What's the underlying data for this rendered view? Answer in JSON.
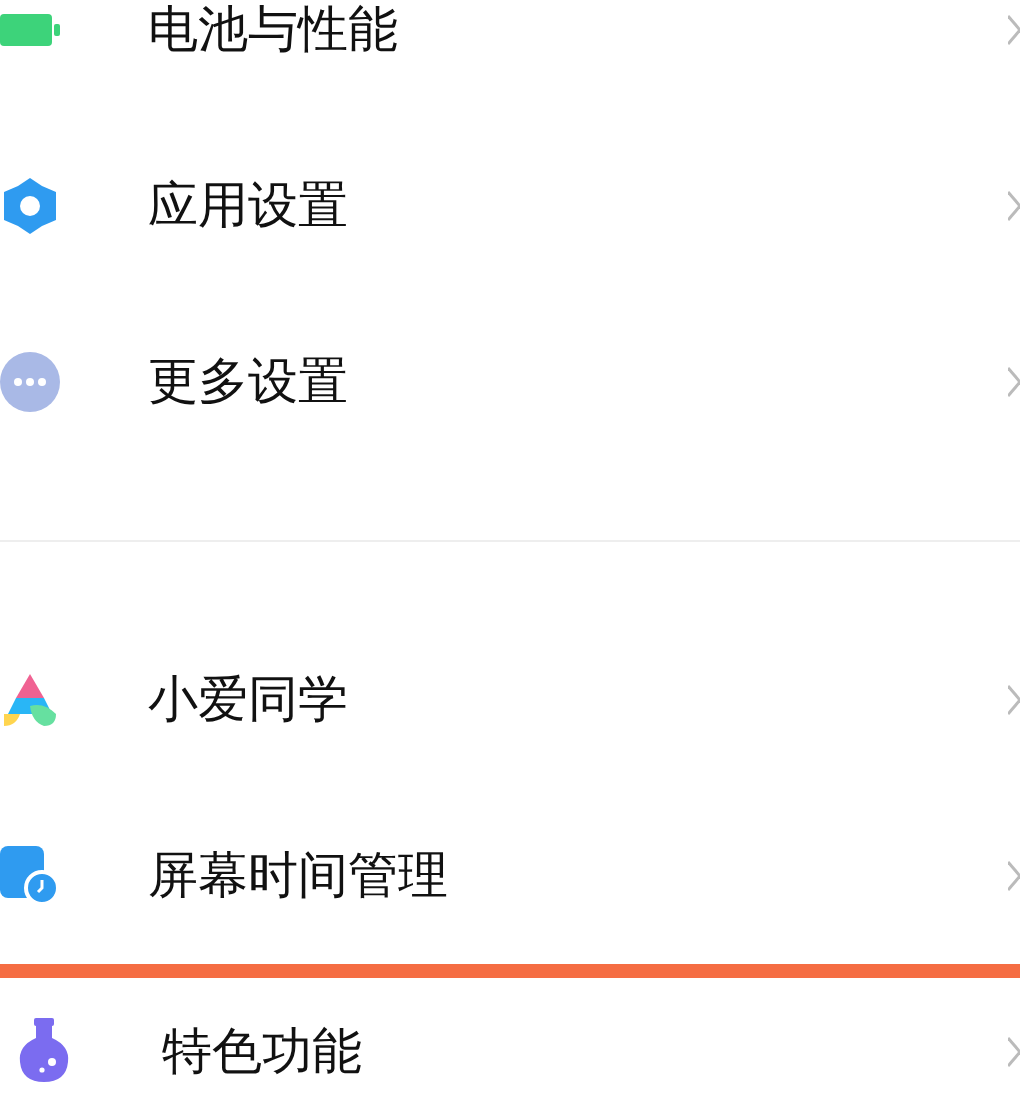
{
  "groups": [
    {
      "items": [
        {
          "label": "电池与性能",
          "kind": "battery",
          "highlighted": false
        },
        {
          "label": "应用设置",
          "kind": "gear",
          "highlighted": false
        },
        {
          "label": "更多设置",
          "kind": "dots",
          "highlighted": false
        }
      ]
    },
    {
      "items": [
        {
          "label": "小爱同学",
          "kind": "assistant",
          "highlighted": false
        },
        {
          "label": "屏幕时间管理",
          "kind": "clock",
          "highlighted": false
        },
        {
          "label": "特色功能",
          "kind": "flask",
          "highlighted": true
        }
      ]
    }
  ]
}
